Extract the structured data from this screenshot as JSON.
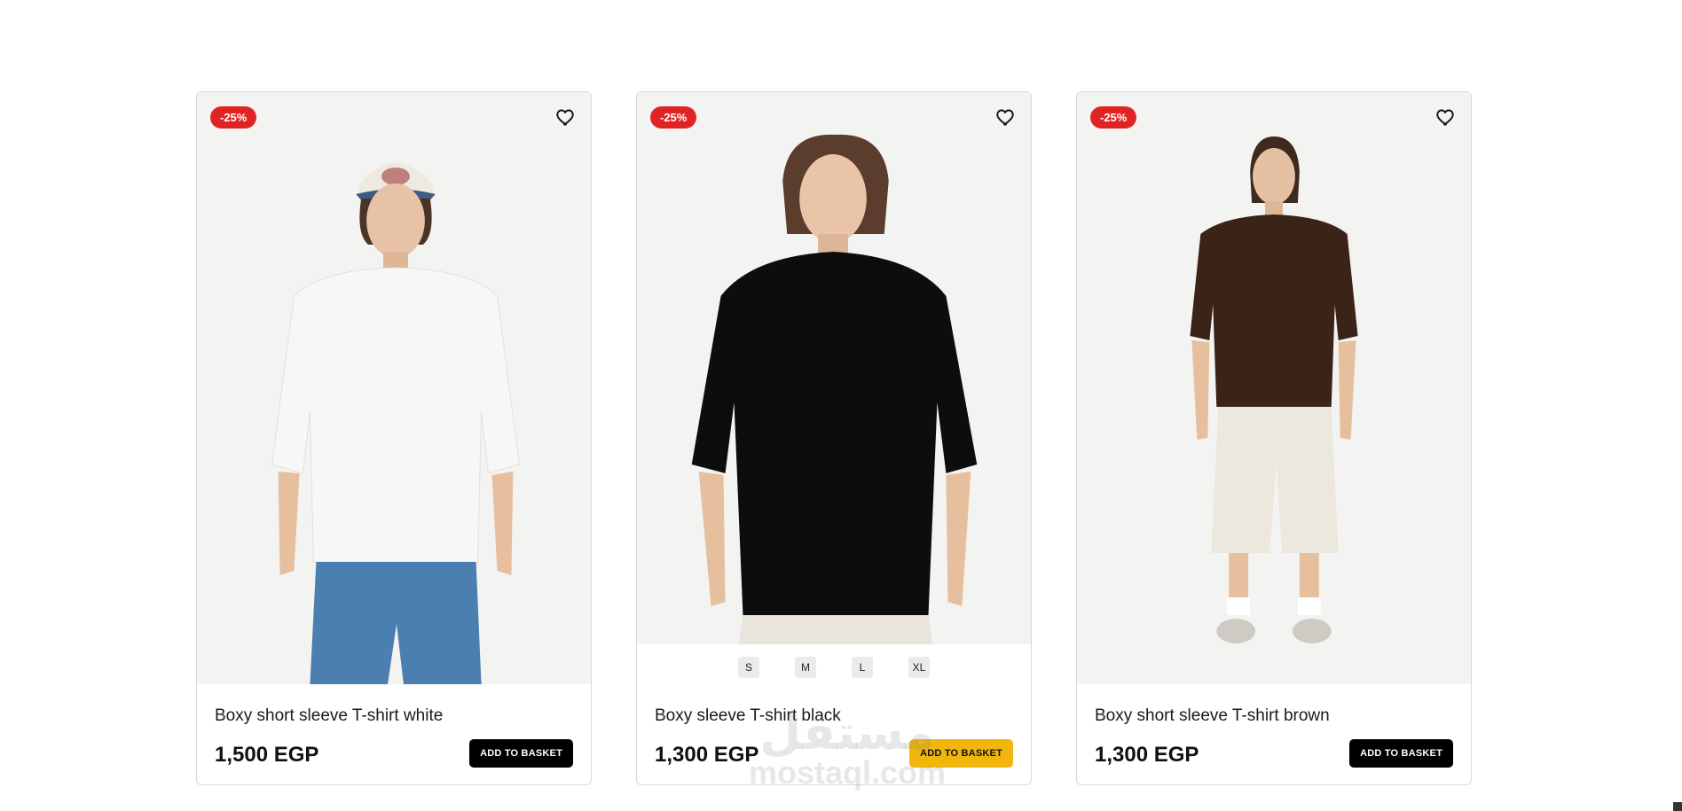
{
  "products": [
    {
      "badge": "-25%",
      "name": "Boxy short sleeve T-shirt white",
      "price": "1,500 EGP",
      "button": "ADD TO BASKET",
      "shirt_color": "#f7f7f5",
      "bottom_color": "#4a7fb0",
      "cap": true
    },
    {
      "badge": "-25%",
      "name": "Boxy sleeve T-shirt black",
      "price": "1,300 EGP",
      "button": "ADD TO BASKET",
      "sizes": [
        "S",
        "M",
        "L",
        "XL"
      ],
      "shirt_color": "#0d0d0d",
      "bottom_color": "#e9e5dc"
    },
    {
      "badge": "-25%",
      "name": "Boxy short sleeve T-shirt brown",
      "price": "1,300 EGP",
      "button": "ADD TO BASKET",
      "shirt_color": "#3a2418",
      "bottom_color": "#ece8dd"
    }
  ],
  "watermark": {
    "arabic": "مستقل",
    "latin": "mostaql.com"
  },
  "colors": {
    "badge": "#e02424",
    "button": "#000000",
    "button_active": "#f1b60c"
  }
}
